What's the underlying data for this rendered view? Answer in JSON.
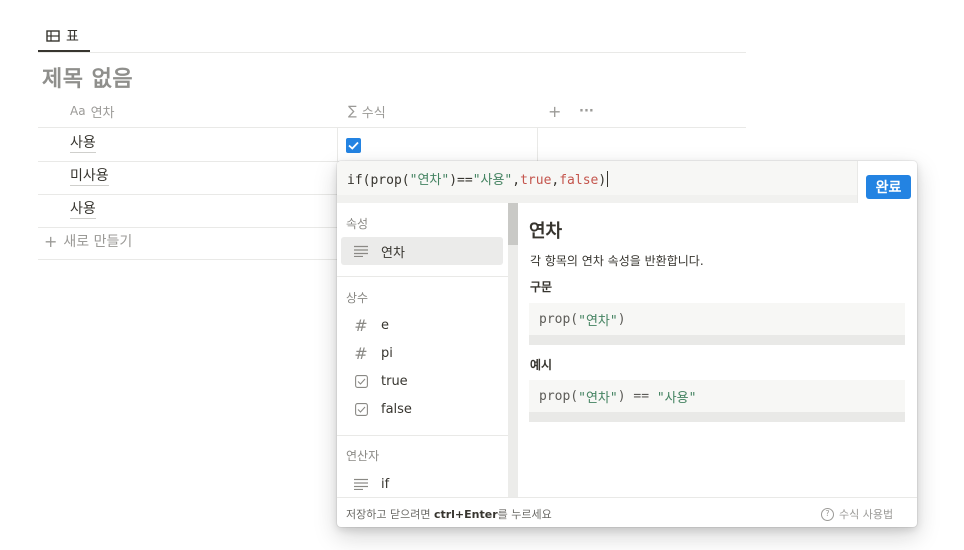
{
  "view_tab": {
    "icon": "table-icon",
    "label": "표"
  },
  "page": {
    "title": "제목 없음"
  },
  "table": {
    "columns": [
      {
        "icon": "Aa",
        "label": "연차"
      },
      {
        "icon": "∑",
        "label": "수식"
      }
    ],
    "add_column": "+",
    "more": "···",
    "rows": [
      {
        "name": "사용",
        "formula_checked": true
      },
      {
        "name": "미사용"
      },
      {
        "name": "사용"
      }
    ],
    "new_row_label": "새로 만들기"
  },
  "formula_editor": {
    "formula_parts": [
      {
        "t": "if(prop(",
        "c": "plain"
      },
      {
        "t": "\"연차\"",
        "c": "str"
      },
      {
        "t": ")==",
        "c": "plain"
      },
      {
        "t": "\"사용\"",
        "c": "str"
      },
      {
        "t": ",",
        "c": "plain"
      },
      {
        "t": "true",
        "c": "kw"
      },
      {
        "t": ",",
        "c": "plain"
      },
      {
        "t": "false",
        "c": "kw"
      },
      {
        "t": ")",
        "c": "plain"
      }
    ],
    "done_label": "완료",
    "sections": {
      "properties": {
        "title": "속성",
        "items": [
          {
            "icon": "text-lines-icon",
            "label": "연차"
          }
        ]
      },
      "constants": {
        "title": "상수",
        "items": [
          {
            "icon": "hash-icon",
            "label": "e"
          },
          {
            "icon": "hash-icon",
            "label": "pi"
          },
          {
            "icon": "checkbox-icon",
            "label": "true"
          },
          {
            "icon": "checkbox-icon",
            "label": "false"
          }
        ]
      },
      "operators": {
        "title": "연산자",
        "items": [
          {
            "icon": "text-lines-icon",
            "label": "if"
          }
        ]
      }
    },
    "doc": {
      "title": "연차",
      "description": "각 항목의 연차 속성을 반환합니다.",
      "syntax_heading": "구문",
      "syntax_parts": [
        {
          "t": "prop(",
          "c": "plain"
        },
        {
          "t": "\"연차\"",
          "c": "str"
        },
        {
          "t": ")",
          "c": "plain"
        }
      ],
      "example_heading": "예시",
      "example_parts": [
        {
          "t": "prop(",
          "c": "plain"
        },
        {
          "t": "\"연차\"",
          "c": "str"
        },
        {
          "t": ") == ",
          "c": "plain"
        },
        {
          "t": "\"사용\"",
          "c": "str"
        }
      ]
    },
    "footer": {
      "hint_prefix": "저장하고 닫으려면 ",
      "hint_keys": "ctrl+Enter",
      "hint_suffix": "를 누르세요",
      "help_icon": "?",
      "help_label": "수식 사용법"
    }
  },
  "colors": {
    "accent": "#2383e2",
    "string": "#448361",
    "keyword": "#c4554d"
  }
}
